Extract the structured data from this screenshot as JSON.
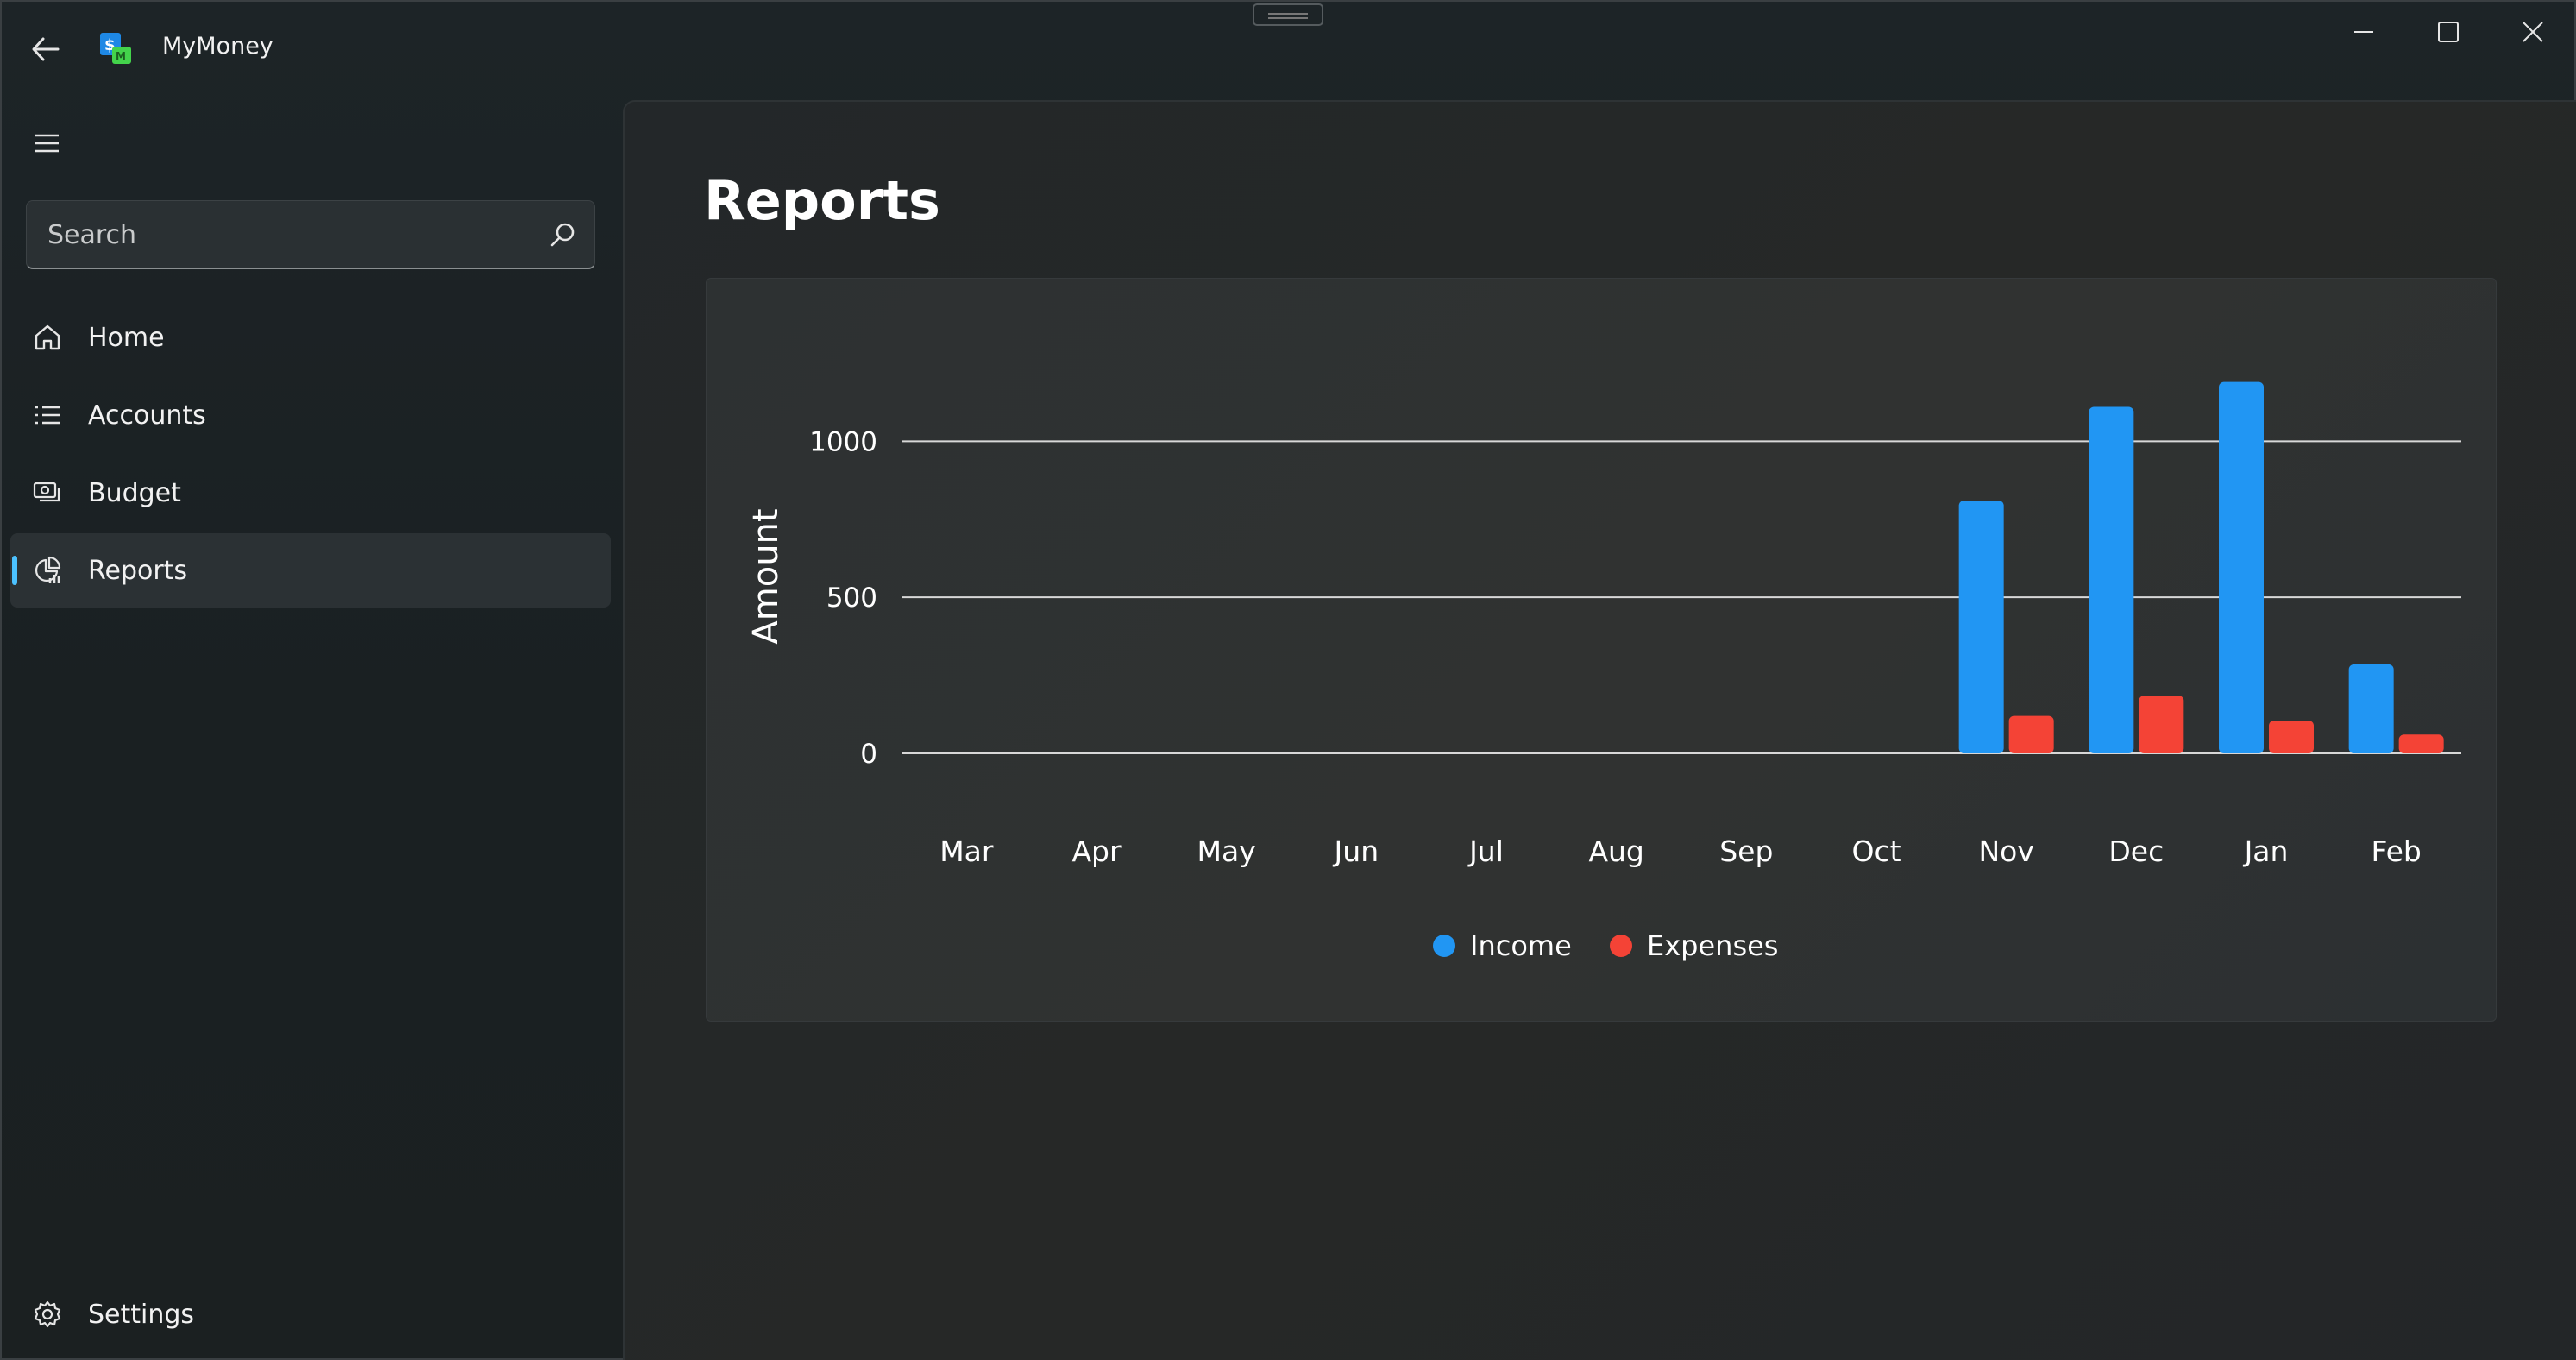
{
  "app": {
    "title": "MyMoney"
  },
  "sidebar": {
    "search": {
      "placeholder": "Search",
      "value": ""
    },
    "items": [
      {
        "label": "Home",
        "icon": "home-icon",
        "active": false
      },
      {
        "label": "Accounts",
        "icon": "list-icon",
        "active": false
      },
      {
        "label": "Budget",
        "icon": "money-icon",
        "active": false
      },
      {
        "label": "Reports",
        "icon": "pie-chart-icon",
        "active": true
      }
    ],
    "settings_label": "Settings"
  },
  "page": {
    "title": "Reports"
  },
  "colors": {
    "income": "#2196f3",
    "expenses": "#f44336",
    "accent": "#4cc2ff"
  },
  "chart_data": {
    "type": "bar",
    "categories": [
      "Mar",
      "Apr",
      "May",
      "Jun",
      "Jul",
      "Aug",
      "Sep",
      "Oct",
      "Nov",
      "Dec",
      "Jan",
      "Feb"
    ],
    "series": [
      {
        "name": "Income",
        "values": [
          0,
          0,
          0,
          0,
          0,
          0,
          0,
          0,
          810,
          1110,
          1190,
          285
        ]
      },
      {
        "name": "Expenses",
        "values": [
          0,
          0,
          0,
          0,
          0,
          0,
          0,
          0,
          120,
          185,
          105,
          60
        ]
      }
    ],
    "ylabel": "Amount",
    "yticks": [
      0,
      500,
      1000
    ],
    "ylim": [
      0,
      1200
    ],
    "grid": true,
    "legend": "bottom-center"
  }
}
